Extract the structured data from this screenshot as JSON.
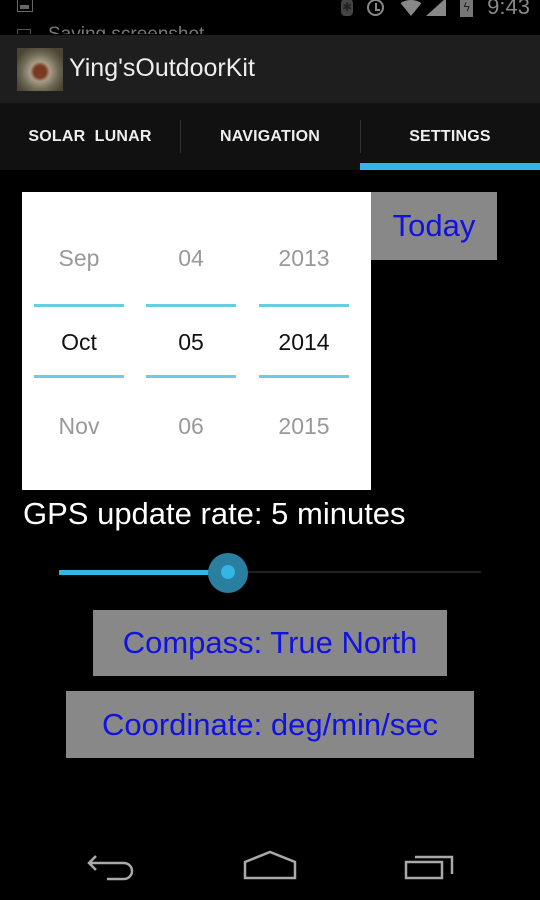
{
  "status_bar": {
    "notification_text": "Saving screenshot",
    "time": "9:43",
    "icons": [
      "image-icon",
      "bluetooth-icon",
      "alarm-icon",
      "wifi-icon",
      "signal-icon",
      "battery-charging-icon"
    ]
  },
  "action_bar": {
    "app_title": "Ying'sOutdoorKit",
    "app_icon": "campfire-photo-icon"
  },
  "tabs": [
    {
      "label": "SOLAR  LUNAR",
      "active": false
    },
    {
      "label": "NAVIGATION",
      "active": false
    },
    {
      "label": "SETTINGS",
      "active": true
    }
  ],
  "date_picker": {
    "month": {
      "prev": "Sep",
      "current": "Oct",
      "next": "Nov"
    },
    "day": {
      "prev": "04",
      "current": "05",
      "next": "06"
    },
    "year": {
      "prev": "2013",
      "current": "2014",
      "next": "2015"
    }
  },
  "today_button": {
    "label": "Today"
  },
  "gps": {
    "label": "GPS update rate: 5 minutes",
    "slider_fraction": 0.4
  },
  "compass_button": {
    "label": "Compass: True North"
  },
  "coordinate_button": {
    "label": "Coordinate: deg/min/sec"
  },
  "colors": {
    "accent": "#33b5e5",
    "button_bg": "#888888",
    "button_text": "#1212e0"
  },
  "nav_bar": {
    "buttons": [
      "back",
      "home",
      "recent-apps"
    ]
  }
}
